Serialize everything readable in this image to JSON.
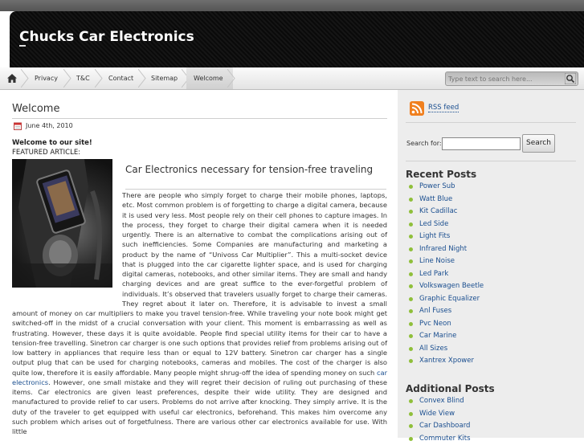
{
  "site": {
    "title": "Chucks Car Electronics"
  },
  "nav": {
    "items": [
      "Privacy",
      "T&C",
      "Contact",
      "Sitemap",
      "Welcome"
    ],
    "active": "Welcome",
    "search_placeholder": "Type text to search here..."
  },
  "post": {
    "title": "Welcome",
    "date": "June 4th, 2010",
    "welcome": "Welcome to our site!",
    "featured": "FEATURED ARTICLE:",
    "article_title": "Car Electronics necessary for tension-free traveling",
    "body_1": "There are people who simply forget to charge their mobile phones, laptops, etc. Most common problem is of forgetting to charge a digital camera, because it is used very less. Most people rely on their cell phones to capture images. In the process, they forget to charge their digital camera when it is needed urgently. There is an alternative to combat the complications arising out of such inefficiencies. Some Companies are manufacturing and marketing a product by the name of “Univoss Car Multiplier”. This a multi-socket device that is plugged into the car cigarette lighter space, and is used for charging digital cameras, notebooks, and other similar items. They are small and handy charging devices and are great suffice to the ever-forgetful problem of individuals. It’s observed that travelers usually forget to charge their cameras. They regret about it later on. Therefore, it is advisable to invest a small amount of money on car multipliers to make you travel tension-free. While traveling your note book might get switched-off in the midst of a crucial conversation with your client. This moment is embarrassing as well as frustrating. However, these days it is quite avoidable. People find special utility items for their car to have a tension-free travelling. Sinetron car charger is one such options that provides relief from problems arising out of low battery in appliances that require less than or equal to 12V battery. Sinetron car charger has a single output plug that can be used for charging notebooks, cameras and mobiles. The cost of the charger is also quite low, therefore it is easily affordable. Many people might shrug-off the idea of spending money on such ",
    "link_text": "car electronics",
    "body_2": ". However, one small mistake and they will regret their decision of ruling out purchasing of these items. Car electronics are given least preferences, despite their wide utility. They are designed and manufactured to provide relief to car users. Problems do not arrive after knocking. They simply arrive. It is the duty of the traveler to get equipped with useful car electronics, beforehand. This makes him overcome any such problem which arises out of forgetfulness. There are various other car electronics available for use. With little"
  },
  "sidebar": {
    "rss_label": "RSS feed",
    "search_label": "Search for:",
    "search_button": "Search",
    "recent_heading": "Recent Posts",
    "recent_posts": [
      "Power Sub",
      "Watt Blue",
      "Kit Cadillac",
      "Led Side",
      "Light Fits",
      "Infrared Night",
      "Line Noise",
      "Led Park",
      "Volkswagen Beetle",
      "Graphic Equalizer",
      "Anl Fuses",
      "Pvc Neon",
      "Car Marine",
      "All Sizes",
      "Xantrex Xpower"
    ],
    "additional_heading": "Additional Posts",
    "additional_posts": [
      "Convex Blind",
      "Wide View",
      "Car Dashboard",
      "Commuter Kits"
    ]
  },
  "colors": {
    "link": "#1a4e8f",
    "bullet": "#8fbf3a",
    "rss": "#f0801f",
    "header": "#111111"
  }
}
